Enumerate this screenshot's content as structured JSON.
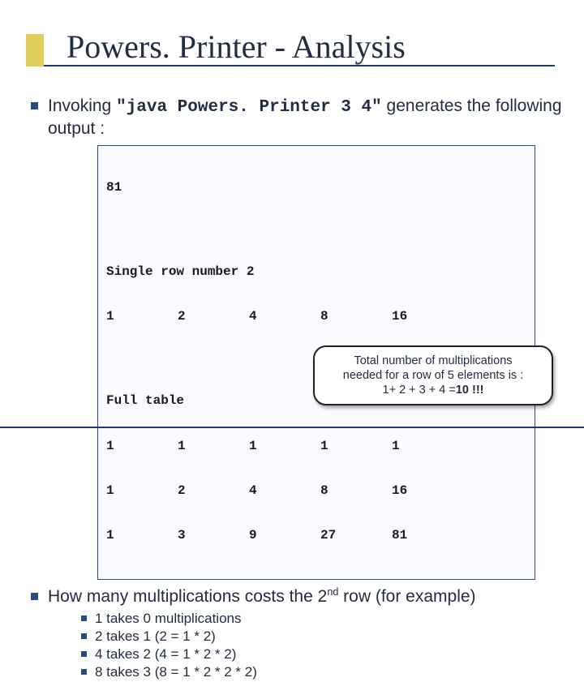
{
  "title": "Powers. Printer - Analysis",
  "intro": {
    "pre": "Invoking ",
    "cmd": "\"java Powers. Printer 3 4\"",
    "post": " generates the following output :"
  },
  "output": {
    "top": "81",
    "single_header": "Single row number 2",
    "single_row": [
      "1",
      "2",
      "4",
      "8",
      "16"
    ],
    "full_header": "Full table",
    "full_rows": [
      [
        "1",
        "1",
        "1",
        "1",
        "1"
      ],
      [
        "1",
        "2",
        "4",
        "8",
        "16"
      ],
      [
        "1",
        "3",
        "9",
        "27",
        "81"
      ]
    ]
  },
  "question": {
    "pre": "How many multiplications costs the 2",
    "sup": "nd",
    "post": " row (for example)"
  },
  "sub": [
    "1 takes 0 multiplications",
    "2 takes 1 (2 = 1 * 2)",
    "4 takes 2 (4 = 1 * 2 * 2)",
    "8 takes 3 (8 = 1 * 2 * 2 * 2)"
  ],
  "callout": {
    "l1": "Total number of multiplications",
    "l2": "needed for a row of 5 elements is :",
    "l3_pre": "1+ 2 + 3 + 4 =",
    "l3_ans": "10 !!!"
  }
}
